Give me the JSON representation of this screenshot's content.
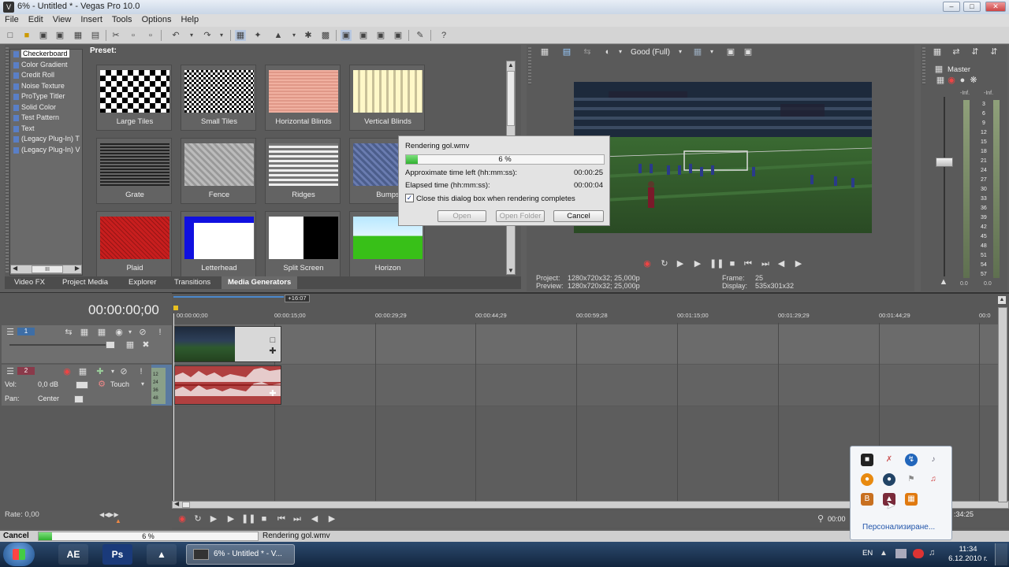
{
  "window": {
    "title": "6% - Untitled * - Vegas Pro 10.0",
    "minimize": "–",
    "maximize": "□",
    "close": "✕"
  },
  "menu": [
    "File",
    "Edit",
    "View",
    "Insert",
    "Tools",
    "Options",
    "Help"
  ],
  "generators": {
    "tree": [
      "Checkerboard",
      "Color Gradient",
      "Credit Roll",
      "Noise Texture",
      "ProType Titler",
      "Solid Color",
      "Test Pattern",
      "Text",
      "(Legacy Plug-In) T",
      "(Legacy Plug-In) V"
    ],
    "selected": "Checkerboard",
    "scroll_handle": "III",
    "preset_label": "Preset:",
    "presets": [
      "Large Tiles",
      "Small Tiles",
      "Horizontal Blinds",
      "Vertical Blinds",
      "Grate",
      "Fence",
      "Ridges",
      "Bumps",
      "Plaid",
      "Letterhead",
      "Split Screen",
      "Horizon"
    ]
  },
  "tabs": [
    "Video FX",
    "Project Media",
    "Explorer",
    "Transitions",
    "Media Generators"
  ],
  "preview": {
    "quality": "Good (Full)",
    "project_label": "Project:",
    "project_value": "1280x720x32; 25,000p",
    "preview_label": "Preview:",
    "preview_value": "1280x720x32; 25,000p",
    "frame_label": "Frame:",
    "frame_value": "25",
    "display_label": "Display:",
    "display_value": "535x301x32"
  },
  "master": {
    "label": "Master",
    "top_left": "-Inf.",
    "top_right": "-Inf.",
    "scale": [
      "3",
      "6",
      "9",
      "12",
      "15",
      "18",
      "21",
      "24",
      "27",
      "30",
      "33",
      "36",
      "39",
      "42",
      "45",
      "48",
      "51",
      "54",
      "57"
    ],
    "bottom_left": "0.0",
    "bottom_right": "0.0"
  },
  "dialog": {
    "title": "Rendering gol.wmv",
    "progress": 6,
    "progress_text": "6 %",
    "approx_label": "Approximate time left (hh:mm:ss):",
    "approx_value": "00:00:25",
    "elapsed_label": "Elapsed time (hh:mm:ss):",
    "elapsed_value": "00:00:04",
    "checkbox_label": "Close this dialog box when rendering completes",
    "checkbox_checked": true,
    "open": "Open",
    "open_folder": "Open Folder",
    "cancel": "Cancel"
  },
  "timeline": {
    "timecode": "00:00:00;00",
    "marker": "+16:07",
    "ruler": [
      "00:00:00;00",
      "00:00:15;00",
      "00:00:29;29",
      "00:00:44;29",
      "00:00:59;28",
      "00:01:15;00",
      "00:01:29;29",
      "00:01:44;29",
      "00:0"
    ],
    "track1_num": "1",
    "track2_num": "2",
    "vol_label": "Vol:",
    "vol_value": "0,0 dB",
    "touch": "Touch",
    "pan_label": "Pan:",
    "pan_value": "Center",
    "audio_scale": [
      "12",
      "24",
      "36",
      "48"
    ],
    "rate": "Rate: 0,00",
    "tc_right": "00:00",
    "tc_end": ":34:25"
  },
  "status": {
    "cancel": "Cancel",
    "progress": 6,
    "progress_text": "6 %",
    "file": "Rendering gol.wmv"
  },
  "taskbar": {
    "apps": [
      "AE",
      "Ps"
    ],
    "active_task": "6% - Untitled * - V...",
    "lang": "EN",
    "time": "11:34",
    "date": "6.12.2010 г.",
    "tray_customize": "Персонализиране..."
  }
}
